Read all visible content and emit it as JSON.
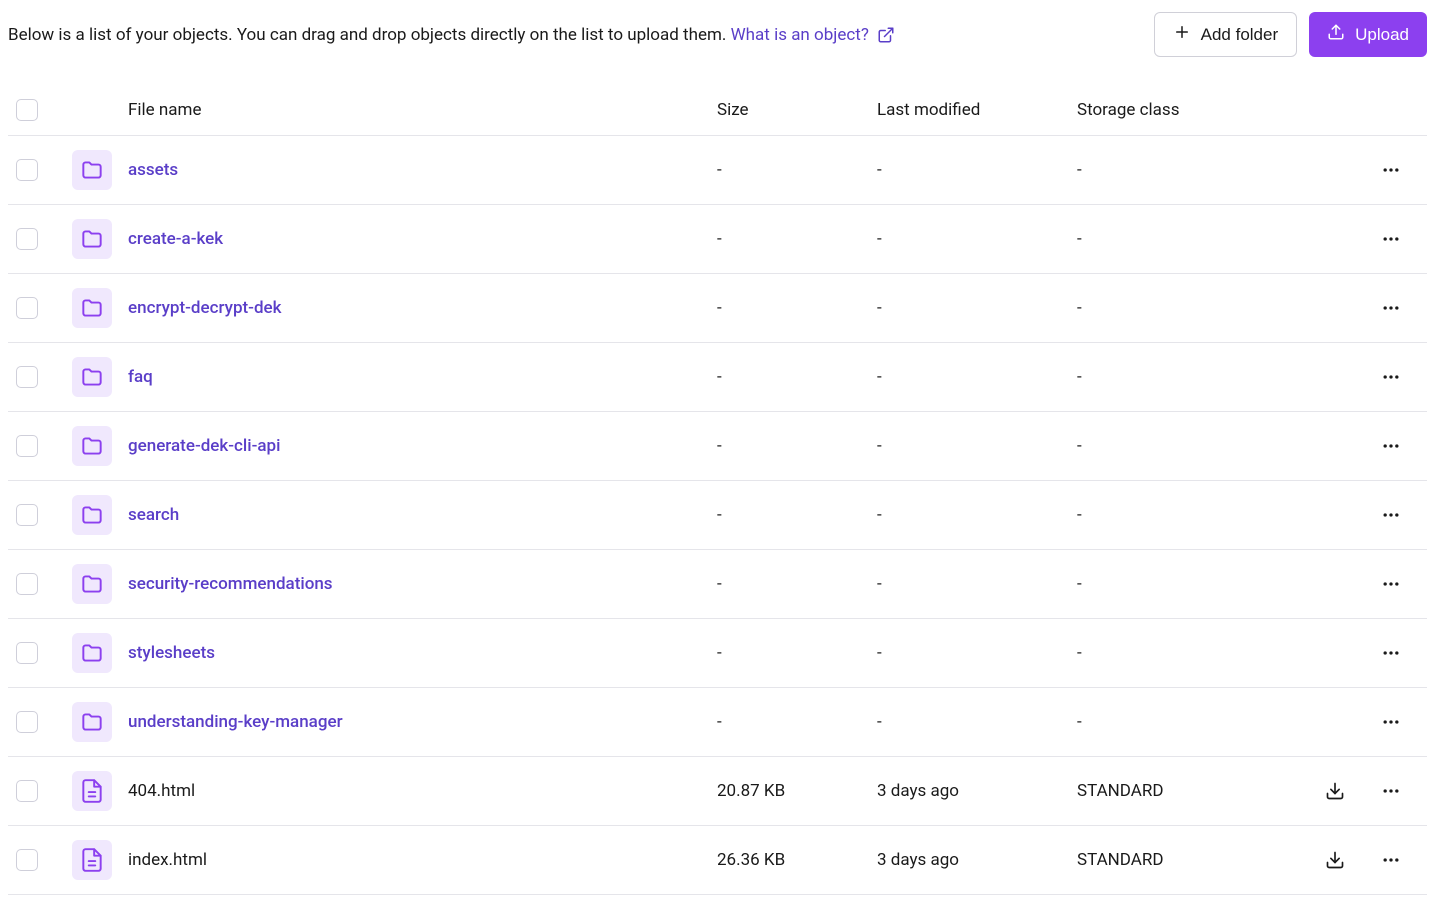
{
  "description": "Below is a list of your objects. You can drag and drop objects directly on the list to upload them. ",
  "whatIsLink": "What is an object?",
  "buttons": {
    "addFolder": "Add folder",
    "upload": "Upload"
  },
  "columns": {
    "fileName": "File name",
    "size": "Size",
    "lastModified": "Last modified",
    "storageClass": "Storage class"
  },
  "items": [
    {
      "type": "folder",
      "name": "assets",
      "size": "-",
      "lastModified": "-",
      "storageClass": "-"
    },
    {
      "type": "folder",
      "name": "create-a-kek",
      "size": "-",
      "lastModified": "-",
      "storageClass": "-"
    },
    {
      "type": "folder",
      "name": "encrypt-decrypt-dek",
      "size": "-",
      "lastModified": "-",
      "storageClass": "-"
    },
    {
      "type": "folder",
      "name": "faq",
      "size": "-",
      "lastModified": "-",
      "storageClass": "-"
    },
    {
      "type": "folder",
      "name": "generate-dek-cli-api",
      "size": "-",
      "lastModified": "-",
      "storageClass": "-"
    },
    {
      "type": "folder",
      "name": "search",
      "size": "-",
      "lastModified": "-",
      "storageClass": "-"
    },
    {
      "type": "folder",
      "name": "security-recommendations",
      "size": "-",
      "lastModified": "-",
      "storageClass": "-"
    },
    {
      "type": "folder",
      "name": "stylesheets",
      "size": "-",
      "lastModified": "-",
      "storageClass": "-"
    },
    {
      "type": "folder",
      "name": "understanding-key-manager",
      "size": "-",
      "lastModified": "-",
      "storageClass": "-"
    },
    {
      "type": "file",
      "name": "404.html",
      "size": "20.87 KB",
      "lastModified": "3 days ago",
      "storageClass": "STANDARD"
    },
    {
      "type": "file",
      "name": "index.html",
      "size": "26.36 KB",
      "lastModified": "3 days ago",
      "storageClass": "STANDARD"
    }
  ]
}
